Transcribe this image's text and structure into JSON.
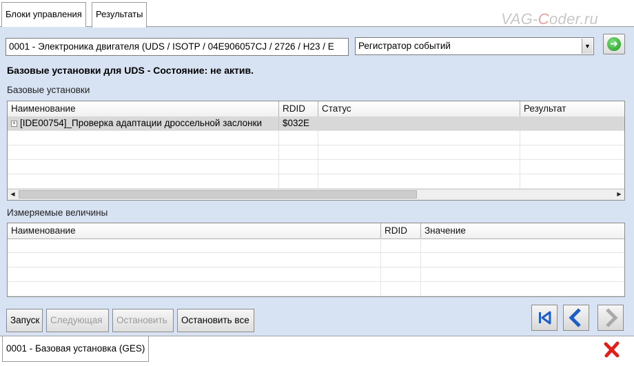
{
  "tabs": [
    {
      "label": "Блоки управления"
    },
    {
      "label": "Результаты"
    }
  ],
  "watermark": {
    "prefix": "VAG-",
    "accent": "C",
    "suffix": "oder.ru"
  },
  "ecu_field": {
    "value": "0001 - Электроника двигателя  (UDS / ISOTP / 04E906057CJ / 2726 / H23 / E"
  },
  "mode_select": {
    "selected": "Регистратор событий"
  },
  "status_line": "Базовые установки для UDS - Состояние: не актив.",
  "basic_settings": {
    "section_label": "Базовые установки",
    "columns": [
      "Наименование",
      "RDID",
      "Статус",
      "Результат"
    ],
    "rows": [
      {
        "name": "[IDE00754]_Проверка адаптации дроссельной заслонки",
        "rdid": "$032E",
        "status": "",
        "result": ""
      }
    ]
  },
  "measured_values": {
    "section_label": "Измеряемые величины",
    "columns": [
      "Наименование",
      "RDID",
      "Значение"
    ]
  },
  "buttons": {
    "start": "Запуск",
    "next": "Следующая",
    "stop": "Остановить",
    "stop_all": "Остановить все"
  },
  "bottom_tab": {
    "label": "0001 - Базовая установка (GES)"
  },
  "icons": {
    "go": "arrow-right-icon",
    "first": "skip-first-icon",
    "prev": "chevron-left-icon",
    "next": "chevron-right-icon",
    "close": "close-x-icon"
  },
  "colors": {
    "background": "#d7e3f3",
    "go_green": "#1a9a1a",
    "nav_blue": "#1b5fc4",
    "close_red": "#e0201a"
  }
}
